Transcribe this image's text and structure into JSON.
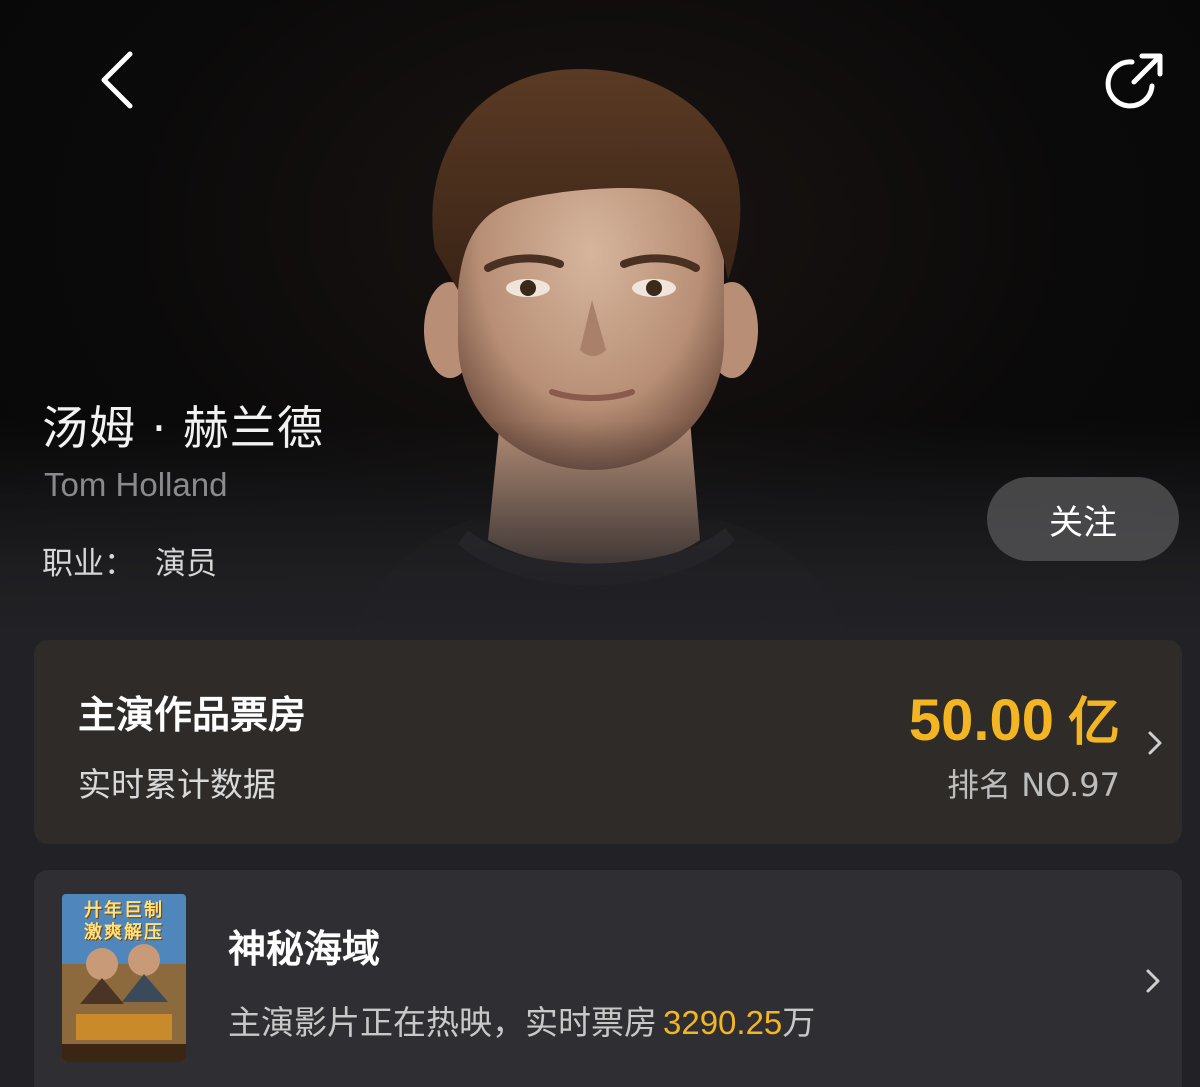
{
  "header": {
    "back_icon": "chevron-left-icon",
    "share_icon": "share-icon"
  },
  "actor": {
    "name_cn": "汤姆 · 赫兰德",
    "name_en": "Tom Holland",
    "profession_label": "职业：",
    "profession_value": "演员",
    "follow_label": "关注"
  },
  "box_office": {
    "title": "主演作品票房",
    "subtitle": "实时累计数据",
    "value": "50.00",
    "unit": "亿",
    "rank": "排名 NO.97",
    "chevron_icon": "chevron-right-icon"
  },
  "now_showing": {
    "poster_line1": "廾年巨制",
    "poster_line2": "激爽解压",
    "title": "神秘海域",
    "desc_prefix": "主演影片正在热映，实时票房",
    "amount": "3290.25",
    "amount_unit": "万",
    "chevron_icon": "chevron-right-icon"
  },
  "colors": {
    "accent_gold": "#f3b521",
    "background": "#222226",
    "card": "#2e2b28"
  }
}
